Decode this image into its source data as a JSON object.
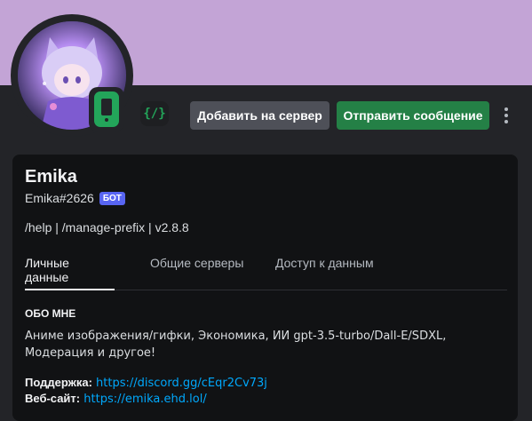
{
  "profile": {
    "display_name": "Emika",
    "tag": "Emika#2626",
    "bot_badge": "БОТ",
    "custom_status": "/help | /manage-prefix | v2.8.8",
    "status": "mobile-online",
    "code_badge_icon": "{/}",
    "banner_color": "#c3a4d6"
  },
  "actions": {
    "add_to_server": "Добавить на сервер",
    "send_message": "Отправить сообщение"
  },
  "tabs": [
    {
      "label": "Личные данные",
      "active": true
    },
    {
      "label": "Общие серверы",
      "active": false
    },
    {
      "label": "Доступ к данным",
      "active": false
    }
  ],
  "about": {
    "title": "ОБО МНЕ",
    "text": "Аниме изображения/гифки, Экономика, ИИ gpt-3.5-turbo/Dall-E/SDXL, Модерация и другое!",
    "support_label": "Поддержка:",
    "support_link": "https://discord.gg/cEqr2Cv73j",
    "site_label": "Веб-сайт:",
    "site_link": "https://emika.ehd.lol/"
  },
  "colors": {
    "accent_green": "#248046",
    "link": "#00a8fc",
    "bot_badge": "#5865f2"
  }
}
